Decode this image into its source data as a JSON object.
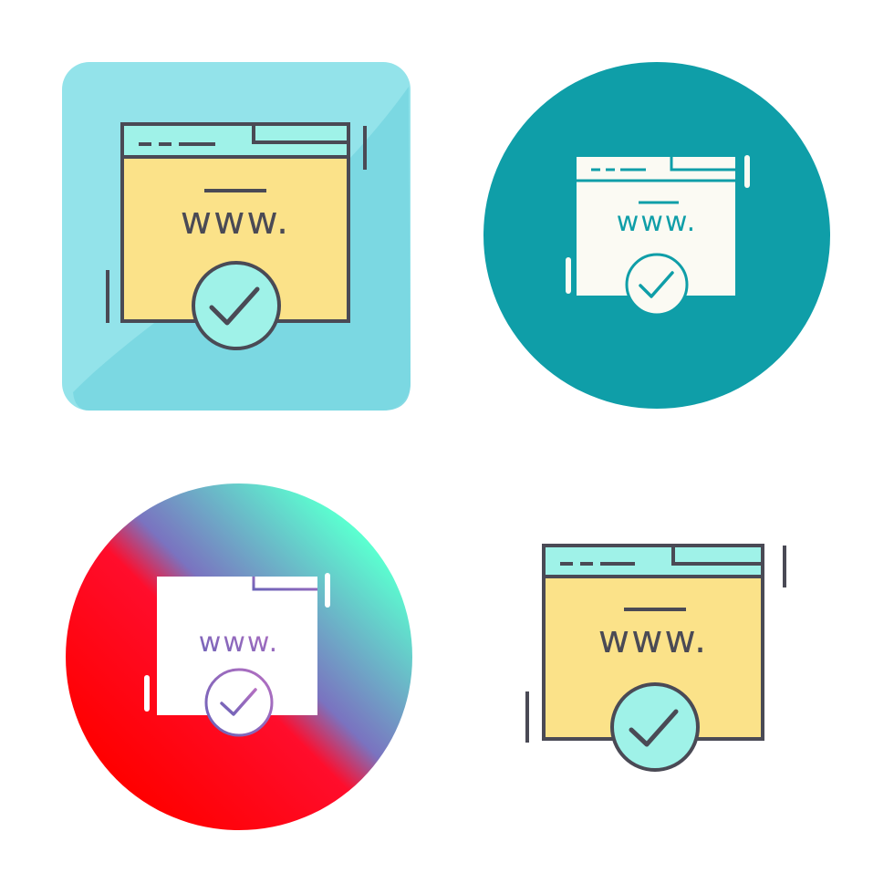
{
  "icons": [
    {
      "variant": "filled-line-on-square",
      "label": "www.",
      "colors": {
        "background_light": "#93e3ea",
        "background_dark": "#70d3df",
        "browser_fill": "#fbe289",
        "browser_header": "#9ff2e8",
        "check_fill": "#9ff2e8",
        "stroke": "#4a4a55"
      },
      "icon_names": [
        "browser-window-icon",
        "check-circle-icon"
      ]
    },
    {
      "variant": "glyph-on-circle",
      "label": "www.",
      "colors": {
        "background": "#0f9ea8",
        "glyph": "#fbfaf3",
        "detail": "#0f9ea8"
      },
      "icon_names": [
        "browser-window-icon",
        "check-circle-icon"
      ]
    },
    {
      "variant": "glyph-on-gradient-circle",
      "label": "www.",
      "colors": {
        "gradient_start": "#ff0000",
        "gradient_mid": "#7a73c0",
        "gradient_end": "#5bffd0",
        "glyph": "#ffffff",
        "detail_gradient_start": "#6b63b8",
        "detail_gradient_end": "#b56fc1"
      },
      "icon_names": [
        "browser-window-icon",
        "check-circle-icon"
      ]
    },
    {
      "variant": "filled-line",
      "label": "www.",
      "colors": {
        "browser_fill": "#fbe289",
        "browser_header": "#9ff2e8",
        "check_fill": "#9ff2e8",
        "stroke": "#4a4a55"
      },
      "icon_names": [
        "browser-window-icon",
        "check-circle-icon"
      ]
    }
  ]
}
